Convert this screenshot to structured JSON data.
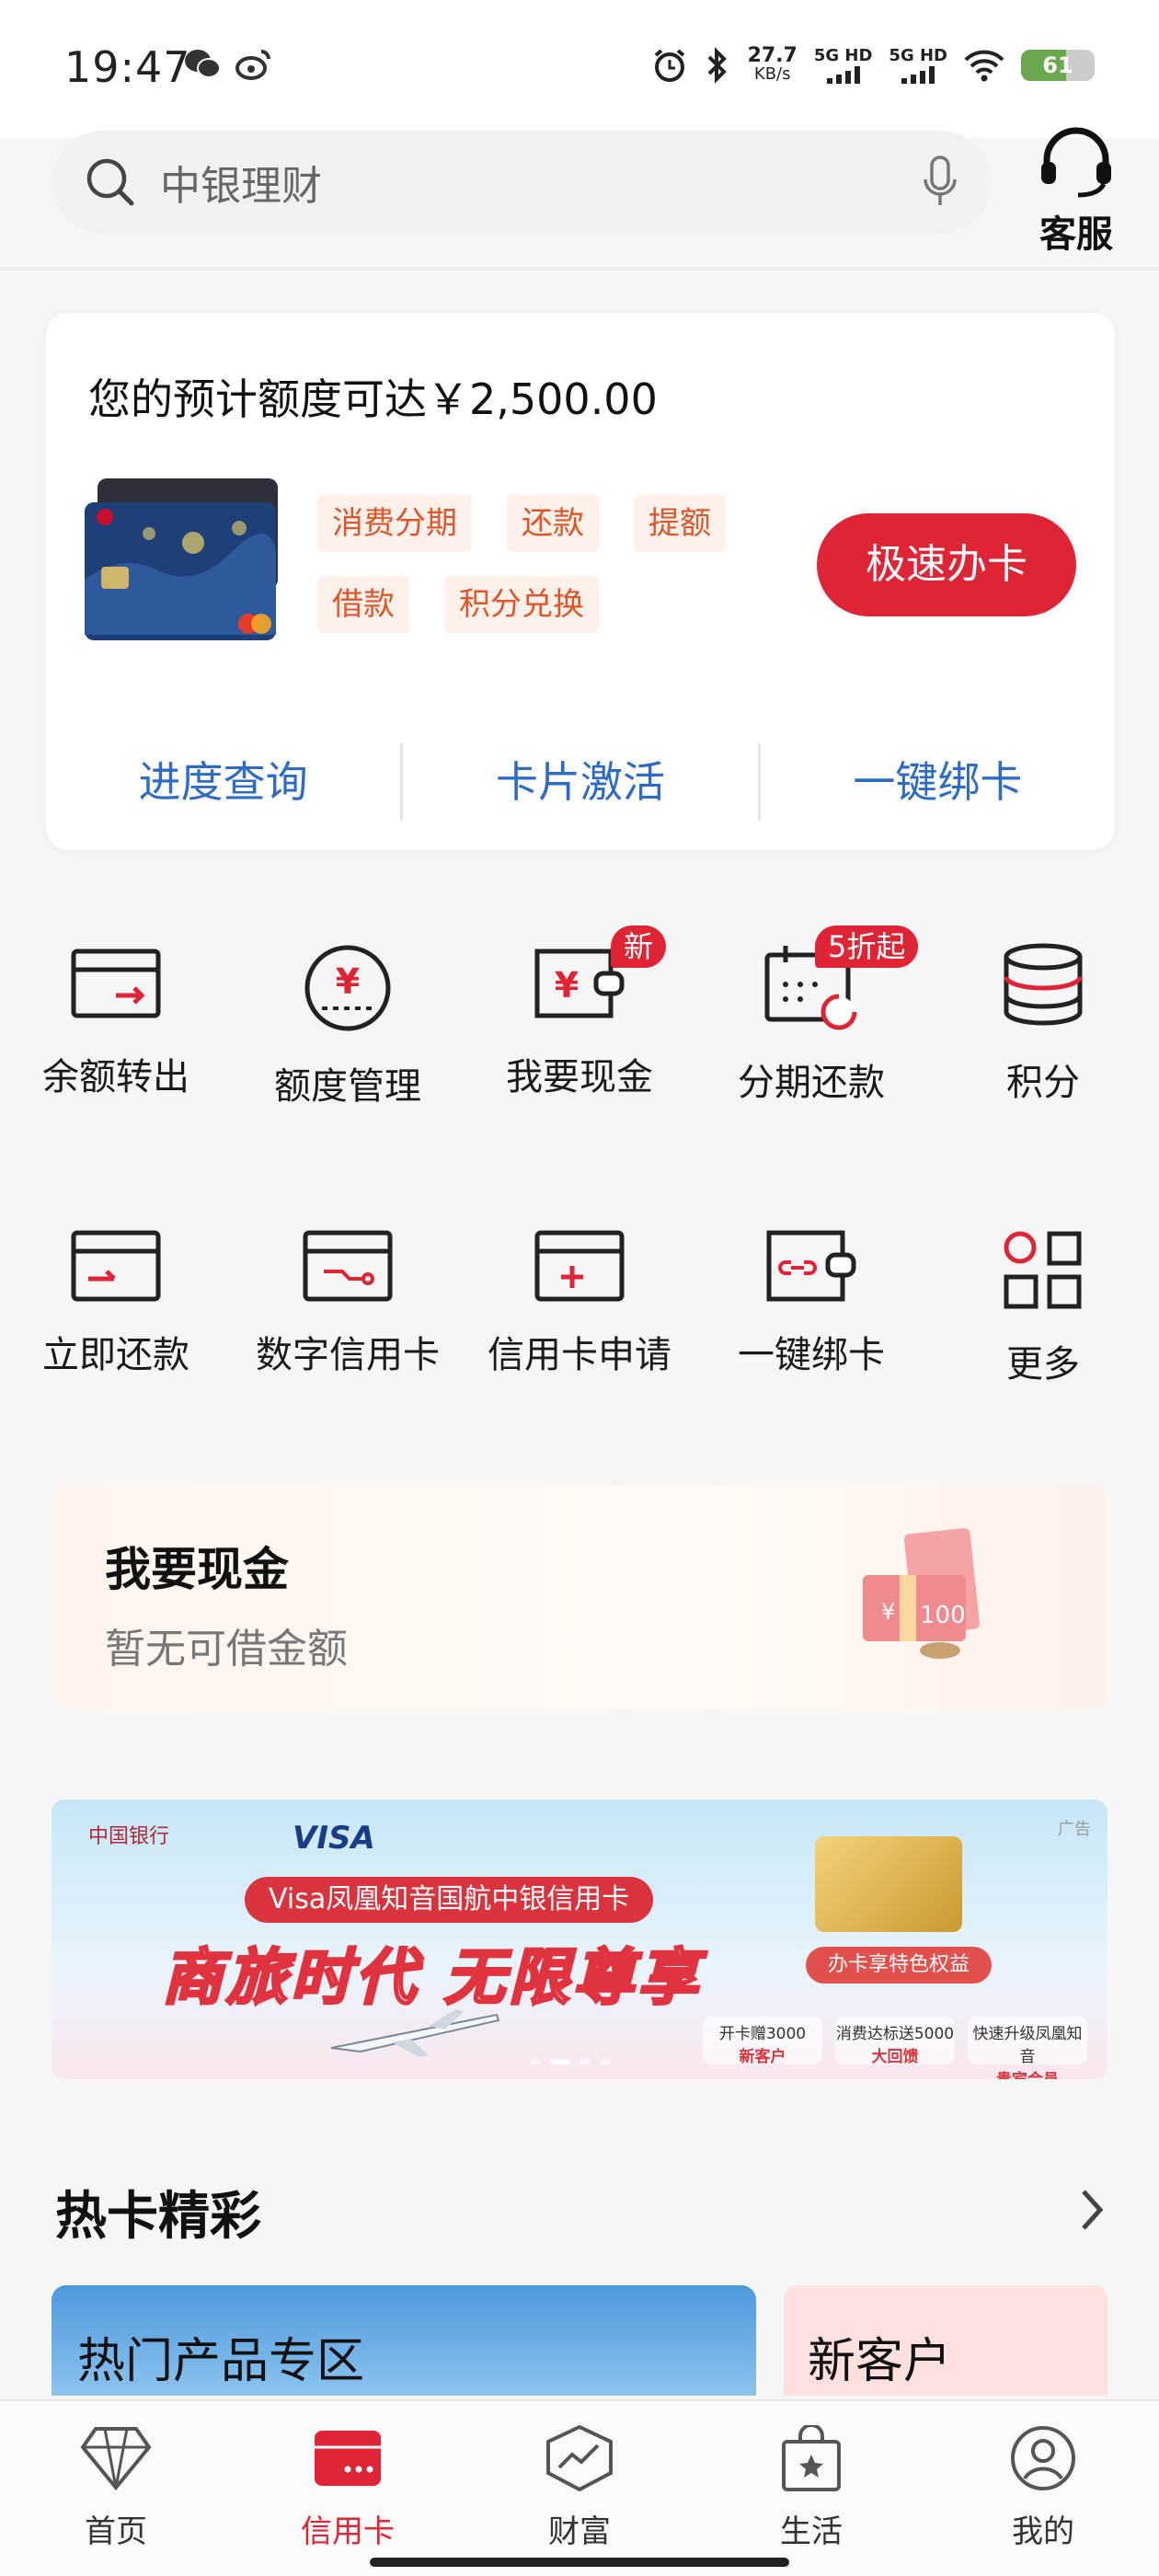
{
  "status_bar": {
    "time": "19:47",
    "net_speed_value": "27.7",
    "net_speed_unit": "KB/s",
    "signal1": "5G HD",
    "signal2": "5G HD",
    "battery": "61",
    "battery_level": 0.61
  },
  "search": {
    "placeholder": "中银理财"
  },
  "service": {
    "label": "客服"
  },
  "credit": {
    "limit_text": "您的预计额度可达￥2,500.00",
    "tags": [
      "消费分期",
      "还款",
      "提额",
      "借款",
      "积分兑换"
    ],
    "apply_button": "极速办卡",
    "links": [
      "进度查询",
      "卡片激活",
      "一键绑卡"
    ]
  },
  "grid_row1": [
    {
      "label": "余额转出",
      "icon": "balance-transfer-icon"
    },
    {
      "label": "额度管理",
      "icon": "limit-management-icon"
    },
    {
      "label": "我要现金",
      "icon": "cash-wallet-icon",
      "badge": "新"
    },
    {
      "label": "分期还款",
      "icon": "installment-calendar-icon",
      "badge": "5折起"
    },
    {
      "label": "积分",
      "icon": "points-stack-icon"
    }
  ],
  "grid_row2": [
    {
      "label": "立即还款",
      "icon": "repay-card-icon"
    },
    {
      "label": "数字信用卡",
      "icon": "digital-card-icon"
    },
    {
      "label": "信用卡申请",
      "icon": "card-apply-icon"
    },
    {
      "label": "一键绑卡",
      "icon": "bind-card-icon"
    },
    {
      "label": "更多",
      "icon": "more-grid-icon"
    }
  ],
  "cash": {
    "title": "我要现金",
    "subtitle": "暂无可借金额"
  },
  "banner": {
    "brand": "中国银行",
    "visa": "VISA",
    "ad": "广告",
    "product": "Visa凤凰知音国航中银信用卡",
    "slogan": "商旅时代 无限尊享",
    "gold_tag": "办卡享特色权益",
    "perks": [
      {
        "line1": "开卡赠3000",
        "line2": "新客户"
      },
      {
        "line1": "消费达标送5000",
        "line2": "大回馈"
      },
      {
        "line1": "快速升级凤凰知音",
        "line2": "贵宾会员"
      }
    ]
  },
  "hot": {
    "title": "热卡精彩",
    "card1": "热门产品专区",
    "card2": "新客户"
  },
  "tabs": [
    {
      "label": "首页",
      "icon": "home-diamond-icon"
    },
    {
      "label": "信用卡",
      "icon": "credit-card-icon",
      "active": true
    },
    {
      "label": "财富",
      "icon": "wealth-chart-icon"
    },
    {
      "label": "生活",
      "icon": "life-bag-icon"
    },
    {
      "label": "我的",
      "icon": "profile-icon"
    }
  ]
}
